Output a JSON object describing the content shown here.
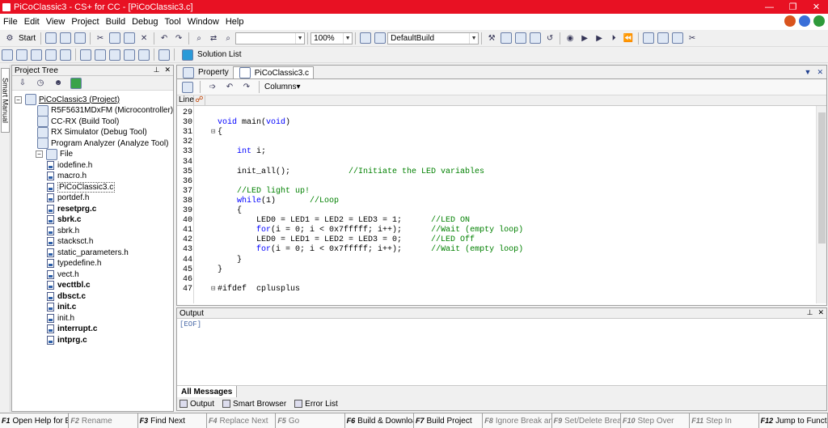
{
  "window": {
    "title": "PiCoClassic3 - CS+ for CC - [PiCoClassic3.c]",
    "minimize": "—",
    "restore": "❐",
    "close": "✕"
  },
  "menu": [
    "File",
    "Edit",
    "View",
    "Project",
    "Build",
    "Debug",
    "Tool",
    "Window",
    "Help"
  ],
  "toolbar": {
    "start_label": "Start",
    "zoom_value": "100%",
    "build_config": "DefaultBuild",
    "solution_list": "Solution List"
  },
  "side_tab": "Smart Manual",
  "project_tree": {
    "title": "Project Tree",
    "items": [
      {
        "label": "PiCoClassic3 (Project)",
        "level": 0,
        "expander": "−",
        "kind": "project"
      },
      {
        "label": "R5F5631MDxFM (Microcontroller)",
        "level": 1,
        "kind": "chip"
      },
      {
        "label": "CC-RX (Build Tool)",
        "level": 1,
        "kind": "tool"
      },
      {
        "label": "RX Simulator (Debug Tool)",
        "level": 1,
        "kind": "tool"
      },
      {
        "label": "Program Analyzer (Analyze Tool)",
        "level": 1,
        "kind": "tool"
      },
      {
        "label": "File",
        "level": 1,
        "expander": "−",
        "kind": "folder"
      },
      {
        "label": "iodefine.h",
        "level": 2,
        "kind": "file"
      },
      {
        "label": "macro.h",
        "level": 2,
        "kind": "file"
      },
      {
        "label": "PiCoClassic3.c",
        "level": 2,
        "kind": "file",
        "selected": true
      },
      {
        "label": "portdef.h",
        "level": 2,
        "kind": "file"
      },
      {
        "label": "resetprg.c",
        "level": 2,
        "kind": "file",
        "bold": true
      },
      {
        "label": "sbrk.c",
        "level": 2,
        "kind": "file",
        "bold": true
      },
      {
        "label": "sbrk.h",
        "level": 2,
        "kind": "file"
      },
      {
        "label": "stacksct.h",
        "level": 2,
        "kind": "file"
      },
      {
        "label": "static_parameters.h",
        "level": 2,
        "kind": "file"
      },
      {
        "label": "typedefine.h",
        "level": 2,
        "kind": "file"
      },
      {
        "label": "vect.h",
        "level": 2,
        "kind": "file"
      },
      {
        "label": "vecttbl.c",
        "level": 2,
        "kind": "file",
        "bold": true
      },
      {
        "label": "dbsct.c",
        "level": 2,
        "kind": "file",
        "bold": true
      },
      {
        "label": "init.c",
        "level": 2,
        "kind": "file",
        "bold": true
      },
      {
        "label": "init.h",
        "level": 2,
        "kind": "file"
      },
      {
        "label": "interrupt.c",
        "level": 2,
        "kind": "file",
        "bold": true
      },
      {
        "label": "intprg.c",
        "level": 2,
        "kind": "file",
        "bold": true
      }
    ]
  },
  "editor": {
    "tabs": [
      {
        "label": "Property",
        "active": false
      },
      {
        "label": "PiCoClassic3.c",
        "active": true
      }
    ],
    "columns_label": "Columns▾",
    "line_header": "Line",
    "lines": [
      {
        "n": "29",
        "code": "",
        "fold": ""
      },
      {
        "n": "30",
        "code": "void main(void)",
        "fold": ""
      },
      {
        "n": "31",
        "code": "{",
        "fold": "⊟"
      },
      {
        "n": "32",
        "code": "",
        "fold": ""
      },
      {
        "n": "33",
        "code": "    int i;",
        "fold": ""
      },
      {
        "n": "34",
        "code": "",
        "fold": ""
      },
      {
        "n": "35",
        "code": "    init_all();            //Initiate the LED variables",
        "fold": ""
      },
      {
        "n": "36",
        "code": "",
        "fold": ""
      },
      {
        "n": "37",
        "code": "    //LED light up!",
        "fold": ""
      },
      {
        "n": "38",
        "code": "    while(1)       //Loop",
        "fold": ""
      },
      {
        "n": "39",
        "code": "    {",
        "fold": ""
      },
      {
        "n": "40",
        "code": "        LED0 = LED1 = LED2 = LED3 = 1;      //LED ON",
        "fold": ""
      },
      {
        "n": "41",
        "code": "        for(i = 0; i < 0x7fffff; i++);      //Wait (empty loop)",
        "fold": ""
      },
      {
        "n": "42",
        "code": "        LED0 = LED1 = LED2 = LED3 = 0;      //LED Off",
        "fold": ""
      },
      {
        "n": "43",
        "code": "        for(i = 0; i < 0x7fffff; i++);      //Wait (empty loop)",
        "fold": ""
      },
      {
        "n": "44",
        "code": "    }",
        "fold": ""
      },
      {
        "n": "45",
        "code": "}",
        "fold": ""
      },
      {
        "n": "46",
        "code": "",
        "fold": ""
      },
      {
        "n": "47",
        "code": "#ifdef  cplusplus",
        "fold": "⊟"
      }
    ]
  },
  "output": {
    "title": "Output",
    "content": "[EOF]",
    "message_tab": "All Messages",
    "bottom_tabs": [
      "Output",
      "Smart Browser",
      "Error List"
    ]
  },
  "function_keys": [
    {
      "key": "F1",
      "label": "Open Help for E...",
      "enabled": true
    },
    {
      "key": "F2",
      "label": "Rename",
      "enabled": false
    },
    {
      "key": "F3",
      "label": "Find Next",
      "enabled": true
    },
    {
      "key": "F4",
      "label": "Replace Next",
      "enabled": false
    },
    {
      "key": "F5",
      "label": "Go",
      "enabled": false
    },
    {
      "key": "F6",
      "label": "Build & Downloa...",
      "enabled": true
    },
    {
      "key": "F7",
      "label": "Build Project",
      "enabled": true
    },
    {
      "key": "F8",
      "label": "Ignore Break an...",
      "enabled": false
    },
    {
      "key": "F9",
      "label": "Set/Delete Break",
      "enabled": false
    },
    {
      "key": "F10",
      "label": "Step Over",
      "enabled": false
    },
    {
      "key": "F11",
      "label": "Step In",
      "enabled": false
    },
    {
      "key": "F12",
      "label": "Jump to Function",
      "enabled": true
    }
  ],
  "colors": {
    "titlebar": "#e81123",
    "keyword": "#0000ff",
    "comment": "#008000"
  }
}
